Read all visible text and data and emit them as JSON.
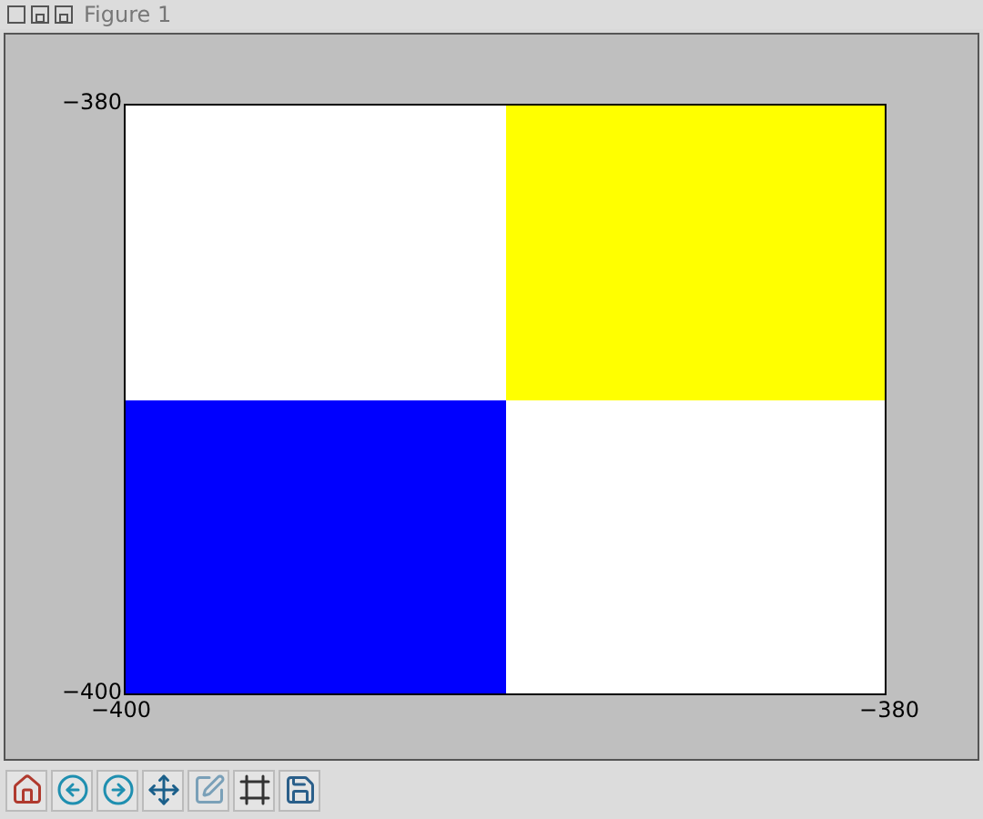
{
  "window": {
    "title": "Figure 1"
  },
  "plot": {
    "y_ticks": [
      "−380",
      "−400"
    ],
    "x_ticks": [
      "−400",
      "−380"
    ],
    "cells": [
      null,
      {
        "color": "#ffff00"
      },
      {
        "color": "#0000ff"
      },
      null
    ]
  }
}
